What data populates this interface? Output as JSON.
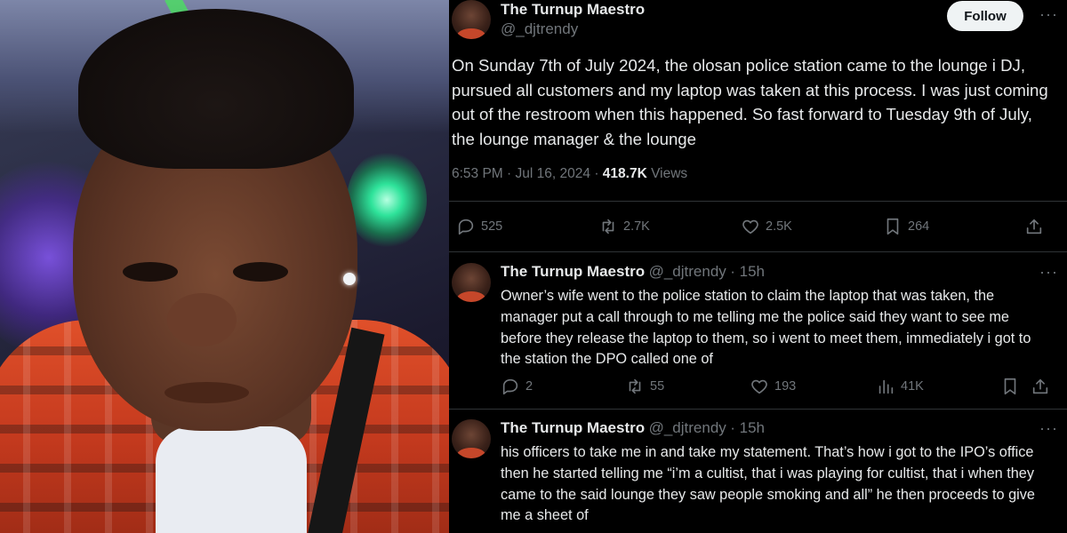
{
  "photo": {
    "alt": ""
  },
  "main_tweet": {
    "author_name": "The Turnup Maestro",
    "author_handle": "@_djtrendy",
    "follow_label": "Follow",
    "more_label": "···",
    "text": "On Sunday 7th of July 2024, the olosan police station came to the lounge i DJ, pursued all customers and my laptop was taken at this process. I was just coming out of the restroom when this happened. So fast forward to Tuesday 9th of July, the lounge manager & the lounge",
    "time": "6:53 PM",
    "date": "Jul 16, 2024",
    "views_count": "418.7K",
    "views_label": "Views",
    "separator": "·",
    "stats": {
      "replies": "525",
      "reposts": "2.7K",
      "likes": "2.5K",
      "bookmarks": "264"
    }
  },
  "replies": [
    {
      "author_name": "The Turnup Maestro",
      "author_handle": "@_djtrendy",
      "age": "· 15h",
      "more_label": "···",
      "text": "Owner’s wife went to the police station to claim the laptop that was taken, the manager put a call through to me telling me the police said they want to see me before they release the laptop to them, so i went to meet them, immediately i got to the station the DPO called one of",
      "stats": {
        "replies": "2",
        "reposts": "55",
        "likes": "193",
        "views": "41K"
      }
    },
    {
      "author_name": "The Turnup Maestro",
      "author_handle": "@_djtrendy",
      "age": "· 15h",
      "more_label": "···",
      "text": "his officers to take me in and take my statement. That’s how i got to the IPO’s office then he started telling me “i’m a cultist, that i was playing for cultist, that i when they came to the said lounge they saw people smoking and all” he then proceeds to give me a sheet of"
    }
  ],
  "colors": {
    "background": "#000000",
    "text": "#e7e9ea",
    "muted": "#71767b",
    "divider": "#2f3336",
    "follow_bg": "#eff3f4"
  },
  "icons": [
    "reply-icon",
    "repost-icon",
    "like-icon",
    "bookmark-icon",
    "share-icon",
    "views-icon"
  ]
}
